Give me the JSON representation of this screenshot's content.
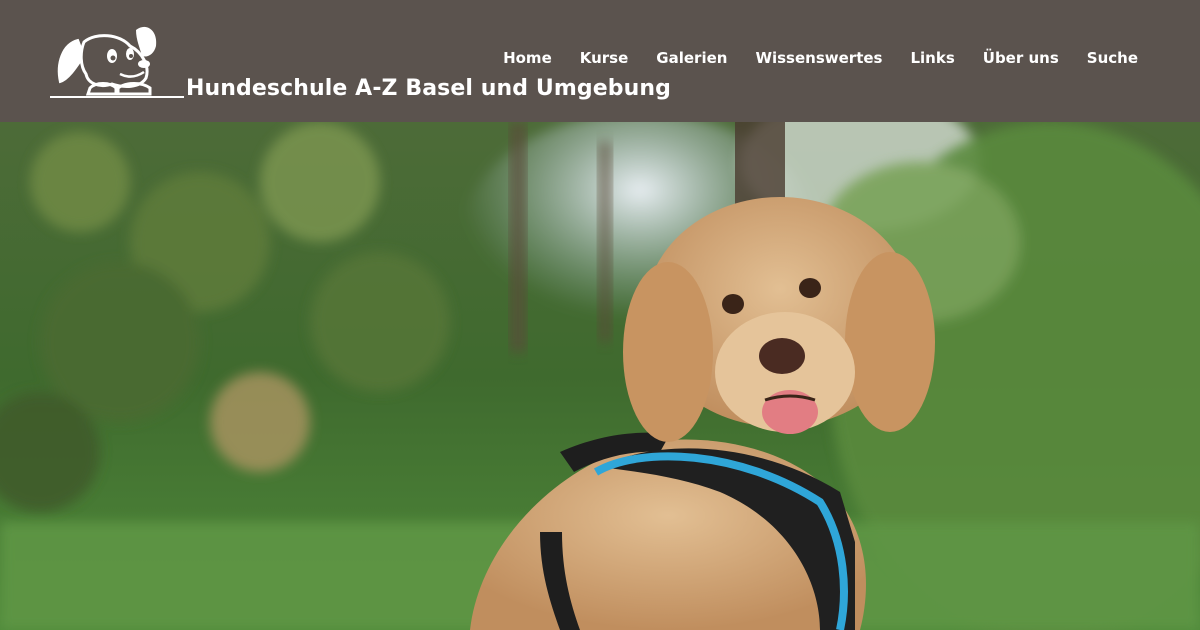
{
  "header": {
    "site_title": "Hundeschule A-Z Basel und Umgebung",
    "logo_icon": "cartoon-dog-logo",
    "background_color": "#5b534e"
  },
  "nav": {
    "items": [
      {
        "label": "Home"
      },
      {
        "label": "Kurse"
      },
      {
        "label": "Galerien"
      },
      {
        "label": "Wissenswertes"
      },
      {
        "label": "Links"
      },
      {
        "label": "Über uns"
      },
      {
        "label": "Suche"
      }
    ]
  },
  "hero": {
    "image": "curly-brown-dog-with-blue-harness-in-grass",
    "accent_color": "#2fa6d8"
  }
}
